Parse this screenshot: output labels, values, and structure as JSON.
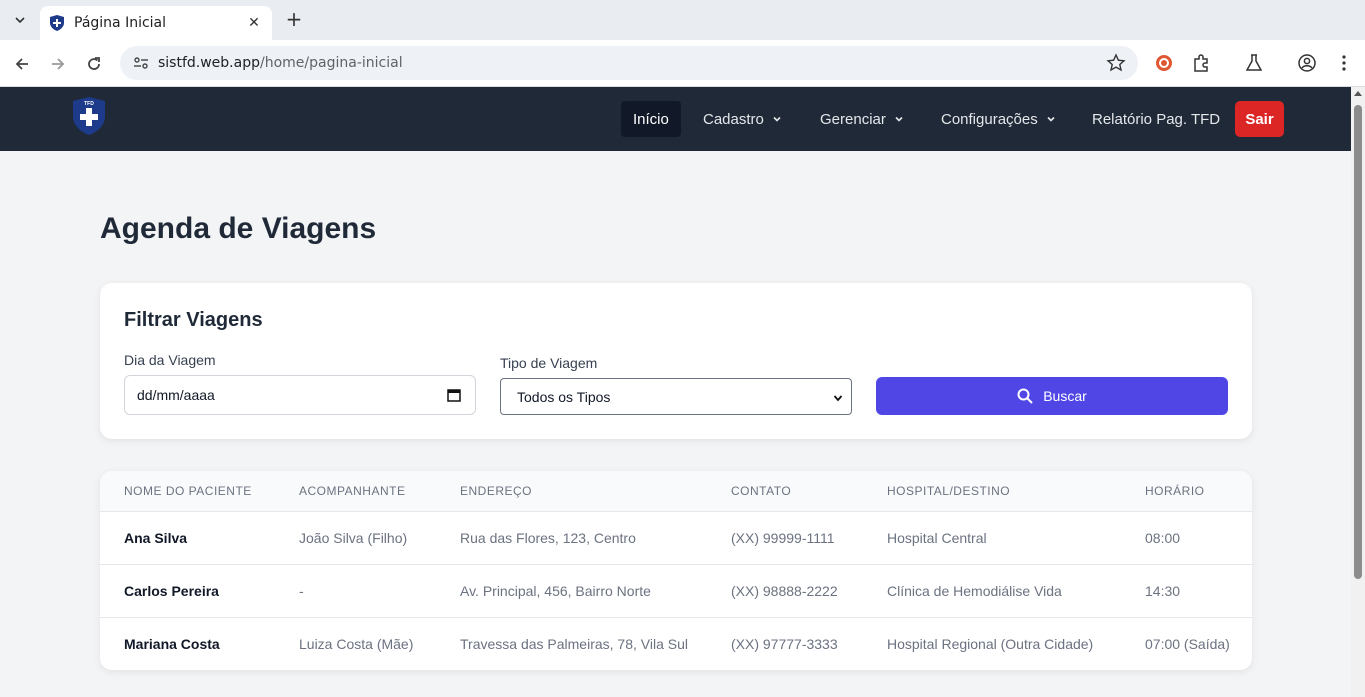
{
  "browser": {
    "tab_title": "Página Inicial",
    "url_host": "sistfd.web.app",
    "url_path": "/home/pagina-inicial"
  },
  "navbar": {
    "logo_text": "TFD",
    "items": [
      {
        "label": "Início",
        "active": true
      },
      {
        "label": "Cadastro",
        "dropdown": true
      },
      {
        "label": "Gerenciar",
        "dropdown": true
      },
      {
        "label": "Configurações",
        "dropdown": true
      },
      {
        "label": "Relatório Pag. TFD"
      }
    ],
    "logout_label": "Sair",
    "colors": {
      "bg": "#1f2937",
      "logout": "#dc2626"
    }
  },
  "page": {
    "title": "Agenda de Viagens"
  },
  "filter": {
    "title": "Filtrar Viagens",
    "date_label": "Dia da Viagem",
    "date_placeholder": "dd/mm/aaaa",
    "type_label": "Tipo de Viagem",
    "type_selected": "Todos os Tipos",
    "search_label": "Buscar",
    "search_color": "#4f46e5"
  },
  "table": {
    "headers": [
      "NOME DO PACIENTE",
      "ACOMPANHANTE",
      "ENDEREÇO",
      "CONTATO",
      "HOSPITAL/DESTINO",
      "HORÁRIO"
    ],
    "rows": [
      {
        "paciente": "Ana Silva",
        "acompanhante": "João Silva (Filho)",
        "endereco": "Rua das Flores, 123, Centro",
        "contato": "(XX) 99999-1111",
        "destino": "Hospital Central",
        "horario": "08:00"
      },
      {
        "paciente": "Carlos Pereira",
        "acompanhante": "-",
        "endereco": "Av. Principal, 456, Bairro Norte",
        "contato": "(XX) 98888-2222",
        "destino": "Clínica de Hemodiálise Vida",
        "horario": "14:30"
      },
      {
        "paciente": "Mariana Costa",
        "acompanhante": "Luiza Costa (Mãe)",
        "endereco": "Travessa das Palmeiras, 78, Vila Sul",
        "contato": "(XX) 97777-3333",
        "destino": "Hospital Regional (Outra Cidade)",
        "horario": "07:00 (Saída)"
      }
    ]
  }
}
